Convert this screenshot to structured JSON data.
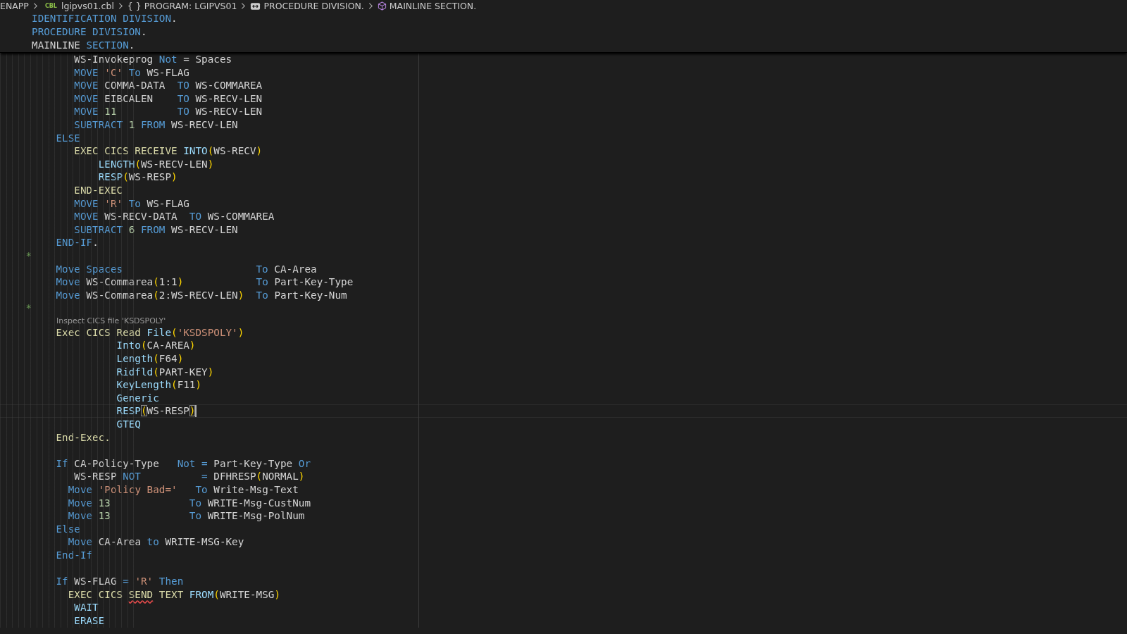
{
  "breadcrumb": [
    {
      "kind": "text",
      "text": "ENAPP"
    },
    {
      "kind": "file",
      "badge": "CBL",
      "text": "lgipvs01.cbl"
    },
    {
      "kind": "braces",
      "glyph": "{ }",
      "text": "PROGRAM: LGIPVS01"
    },
    {
      "kind": "division",
      "text": "PROCEDURE DIVISION."
    },
    {
      "kind": "section",
      "text": "MAINLINE SECTION."
    }
  ],
  "sticky_lines": [
    {
      "kind": "code",
      "tokens": [
        {
          "text": "     IDENTIFICATION DIVISION",
          "kind": "kw"
        },
        {
          "text": ".",
          "kind": "id"
        }
      ]
    },
    {
      "kind": "code",
      "tokens": [
        {
          "text": "     PROCEDURE DIVISION",
          "kind": "kw"
        },
        {
          "text": ".",
          "kind": "id"
        }
      ]
    },
    {
      "kind": "code",
      "tokens": [
        {
          "text": "     MAINLINE ",
          "kind": "id"
        },
        {
          "text": "SECTION",
          "kind": "kw"
        },
        {
          "text": ".",
          "kind": "id"
        }
      ]
    }
  ],
  "lines": [
    {
      "kind": "code",
      "tokens": [
        {
          "text": "            WS-Invokeprog ",
          "kind": "id"
        },
        {
          "text": "Not",
          "kind": "kw"
        },
        {
          "text": " = Spaces",
          "kind": "id"
        }
      ]
    },
    {
      "kind": "code",
      "tokens": [
        {
          "text": "            MOVE ",
          "kind": "kw"
        },
        {
          "text": "'C' ",
          "kind": "str"
        },
        {
          "text": "To ",
          "kind": "kw"
        },
        {
          "text": "WS-FLAG",
          "kind": "id"
        }
      ]
    },
    {
      "kind": "code",
      "tokens": [
        {
          "text": "            MOVE ",
          "kind": "kw"
        },
        {
          "text": "COMMA-DATA  ",
          "kind": "id"
        },
        {
          "text": "TO ",
          "kind": "kw"
        },
        {
          "text": "WS-COMMAREA",
          "kind": "id"
        }
      ]
    },
    {
      "kind": "code",
      "tokens": [
        {
          "text": "            MOVE ",
          "kind": "kw"
        },
        {
          "text": "EIBCALEN    ",
          "kind": "id"
        },
        {
          "text": "TO ",
          "kind": "kw"
        },
        {
          "text": "WS-RECV-LEN",
          "kind": "id"
        }
      ]
    },
    {
      "kind": "code",
      "tokens": [
        {
          "text": "            MOVE ",
          "kind": "kw"
        },
        {
          "text": "11          ",
          "kind": "num"
        },
        {
          "text": "TO ",
          "kind": "kw"
        },
        {
          "text": "WS-RECV-LEN",
          "kind": "id"
        }
      ]
    },
    {
      "kind": "code",
      "tokens": [
        {
          "text": "            SUBTRACT ",
          "kind": "kw"
        },
        {
          "text": "1 ",
          "kind": "num"
        },
        {
          "text": "FROM ",
          "kind": "kw"
        },
        {
          "text": "WS-RECV-LEN",
          "kind": "id"
        }
      ]
    },
    {
      "kind": "code",
      "tokens": [
        {
          "text": "         ELSE",
          "kind": "kw"
        }
      ]
    },
    {
      "kind": "code",
      "tokens": [
        {
          "text": "            EXEC CICS RECEIVE ",
          "kind": "cics"
        },
        {
          "text": "INTO",
          "kind": "fn"
        },
        {
          "text": "(",
          "kind": "paren"
        },
        {
          "text": "WS-RECV",
          "kind": "id"
        },
        {
          "text": ")",
          "kind": "paren"
        }
      ]
    },
    {
      "kind": "code",
      "tokens": [
        {
          "text": "                LENGTH",
          "kind": "fn"
        },
        {
          "text": "(",
          "kind": "paren"
        },
        {
          "text": "WS-RECV-LEN",
          "kind": "id"
        },
        {
          "text": ")",
          "kind": "paren"
        }
      ]
    },
    {
      "kind": "code",
      "tokens": [
        {
          "text": "                RESP",
          "kind": "fn"
        },
        {
          "text": "(",
          "kind": "paren"
        },
        {
          "text": "WS-RESP",
          "kind": "id"
        },
        {
          "text": ")",
          "kind": "paren"
        }
      ]
    },
    {
      "kind": "code",
      "tokens": [
        {
          "text": "            END-EXEC",
          "kind": "cics"
        }
      ]
    },
    {
      "kind": "code",
      "tokens": [
        {
          "text": "            MOVE ",
          "kind": "kw"
        },
        {
          "text": "'R' ",
          "kind": "str"
        },
        {
          "text": "To ",
          "kind": "kw"
        },
        {
          "text": "WS-FLAG",
          "kind": "id"
        }
      ]
    },
    {
      "kind": "code",
      "tokens": [
        {
          "text": "            MOVE ",
          "kind": "kw"
        },
        {
          "text": "WS-RECV-DATA  ",
          "kind": "id"
        },
        {
          "text": "TO ",
          "kind": "kw"
        },
        {
          "text": "WS-COMMAREA",
          "kind": "id"
        }
      ]
    },
    {
      "kind": "code",
      "tokens": [
        {
          "text": "            SUBTRACT ",
          "kind": "kw"
        },
        {
          "text": "6 ",
          "kind": "num"
        },
        {
          "text": "FROM ",
          "kind": "kw"
        },
        {
          "text": "WS-RECV-LEN",
          "kind": "id"
        }
      ]
    },
    {
      "kind": "code",
      "tokens": [
        {
          "text": "         END-IF",
          "kind": "kw"
        },
        {
          "text": ".",
          "kind": "id"
        }
      ]
    },
    {
      "kind": "code",
      "tokens": [
        {
          "text": "    *",
          "kind": "comment"
        }
      ]
    },
    {
      "kind": "code",
      "tokens": [
        {
          "text": "         Move Spaces                      To ",
          "kind": "kw"
        },
        {
          "text": "CA-Area",
          "kind": "id"
        }
      ]
    },
    {
      "kind": "code",
      "tokens": [
        {
          "text": "         Move ",
          "kind": "kw"
        },
        {
          "text": "WS-Commarea",
          "kind": "id"
        },
        {
          "text": "(",
          "kind": "paren"
        },
        {
          "text": "1:1",
          "kind": "id"
        },
        {
          "text": ")",
          "kind": "paren"
        },
        {
          "text": "            To ",
          "kind": "kw"
        },
        {
          "text": "Part-Key-Type",
          "kind": "id"
        }
      ]
    },
    {
      "kind": "code",
      "tokens": [
        {
          "text": "         Move ",
          "kind": "kw"
        },
        {
          "text": "WS-Commarea",
          "kind": "id"
        },
        {
          "text": "(",
          "kind": "paren"
        },
        {
          "text": "2:WS-RECV-LEN",
          "kind": "id"
        },
        {
          "text": ")",
          "kind": "paren"
        },
        {
          "text": "  To ",
          "kind": "kw"
        },
        {
          "text": "Part-Key-Num",
          "kind": "id"
        }
      ]
    },
    {
      "kind": "code",
      "tokens": [
        {
          "text": "    *",
          "kind": "comment"
        }
      ]
    },
    {
      "kind": "lens",
      "text": "Inspect CICS file 'KSDSPOLY'"
    },
    {
      "kind": "code",
      "tokens": [
        {
          "text": "         Exec CICS Read ",
          "kind": "cics"
        },
        {
          "text": "File",
          "kind": "fn"
        },
        {
          "text": "(",
          "kind": "paren"
        },
        {
          "text": "'KSDSPOLY'",
          "kind": "str"
        },
        {
          "text": ")",
          "kind": "paren"
        }
      ]
    },
    {
      "kind": "code",
      "tokens": [
        {
          "text": "                   Into",
          "kind": "fn"
        },
        {
          "text": "(",
          "kind": "paren"
        },
        {
          "text": "CA-AREA",
          "kind": "id"
        },
        {
          "text": ")",
          "kind": "paren"
        }
      ]
    },
    {
      "kind": "code",
      "tokens": [
        {
          "text": "                   Length",
          "kind": "fn"
        },
        {
          "text": "(",
          "kind": "paren"
        },
        {
          "text": "F64",
          "kind": "id"
        },
        {
          "text": ")",
          "kind": "paren"
        }
      ]
    },
    {
      "kind": "code",
      "tokens": [
        {
          "text": "                   Ridfld",
          "kind": "fn"
        },
        {
          "text": "(",
          "kind": "paren"
        },
        {
          "text": "PART-KEY",
          "kind": "id"
        },
        {
          "text": ")",
          "kind": "paren"
        }
      ]
    },
    {
      "kind": "code",
      "tokens": [
        {
          "text": "                   KeyLength",
          "kind": "fn"
        },
        {
          "text": "(",
          "kind": "paren"
        },
        {
          "text": "F11",
          "kind": "id"
        },
        {
          "text": ")",
          "kind": "paren"
        }
      ]
    },
    {
      "kind": "code",
      "tokens": [
        {
          "text": "                   Generic",
          "kind": "fn"
        }
      ]
    },
    {
      "kind": "code",
      "current": true,
      "cursor": true,
      "tokens": [
        {
          "text": "                   RESP",
          "kind": "fn"
        },
        {
          "text": "(",
          "kind": "pmatch"
        },
        {
          "text": "WS-RESP",
          "kind": "id"
        },
        {
          "text": ")",
          "kind": "pmatch"
        }
      ]
    },
    {
      "kind": "code",
      "tokens": [
        {
          "text": "                   GTEQ",
          "kind": "fn"
        }
      ]
    },
    {
      "kind": "code",
      "tokens": [
        {
          "text": "         End-Exec.",
          "kind": "cics"
        }
      ]
    },
    {
      "kind": "blank"
    },
    {
      "kind": "code",
      "tokens": [
        {
          "text": "         If ",
          "kind": "kw"
        },
        {
          "text": "CA-Policy-Type   ",
          "kind": "id"
        },
        {
          "text": "Not = ",
          "kind": "kw"
        },
        {
          "text": "Part-Key-Type ",
          "kind": "id"
        },
        {
          "text": "Or",
          "kind": "kw"
        }
      ]
    },
    {
      "kind": "code",
      "tokens": [
        {
          "text": "            WS-RESP ",
          "kind": "id"
        },
        {
          "text": "NOT          = ",
          "kind": "kw"
        },
        {
          "text": "DFHRESP",
          "kind": "id"
        },
        {
          "text": "(",
          "kind": "paren"
        },
        {
          "text": "NORMAL",
          "kind": "id"
        },
        {
          "text": ")",
          "kind": "paren"
        }
      ]
    },
    {
      "kind": "code",
      "tokens": [
        {
          "text": "           Move ",
          "kind": "kw"
        },
        {
          "text": "'Policy Bad='",
          "kind": "str"
        },
        {
          "text": "   To ",
          "kind": "kw"
        },
        {
          "text": "Write-Msg-Text",
          "kind": "id"
        }
      ]
    },
    {
      "kind": "code",
      "tokens": [
        {
          "text": "           Move ",
          "kind": "kw"
        },
        {
          "text": "13             ",
          "kind": "num"
        },
        {
          "text": "To ",
          "kind": "kw"
        },
        {
          "text": "WRITE-Msg-CustNum",
          "kind": "id"
        }
      ]
    },
    {
      "kind": "code",
      "tokens": [
        {
          "text": "           Move ",
          "kind": "kw"
        },
        {
          "text": "13             ",
          "kind": "num"
        },
        {
          "text": "To ",
          "kind": "kw"
        },
        {
          "text": "WRITE-Msg-PolNum",
          "kind": "id"
        }
      ]
    },
    {
      "kind": "code",
      "tokens": [
        {
          "text": "         Else",
          "kind": "kw"
        }
      ]
    },
    {
      "kind": "code",
      "tokens": [
        {
          "text": "           Move ",
          "kind": "kw"
        },
        {
          "text": "CA-Area ",
          "kind": "id"
        },
        {
          "text": "to ",
          "kind": "kw"
        },
        {
          "text": "WRITE-MSG-Key",
          "kind": "id"
        }
      ]
    },
    {
      "kind": "code",
      "tokens": [
        {
          "text": "         End-If",
          "kind": "kw"
        }
      ]
    },
    {
      "kind": "blank"
    },
    {
      "kind": "code",
      "tokens": [
        {
          "text": "         If ",
          "kind": "kw"
        },
        {
          "text": "WS-FLAG ",
          "kind": "id"
        },
        {
          "text": "= ",
          "kind": "kw"
        },
        {
          "text": "'R' ",
          "kind": "str"
        },
        {
          "text": "Then",
          "kind": "kw"
        }
      ]
    },
    {
      "kind": "code",
      "tokens": [
        {
          "text": "           EXEC CICS ",
          "kind": "cics"
        },
        {
          "text": "SEND",
          "kind": "err"
        },
        {
          "text": " TEXT ",
          "kind": "cics"
        },
        {
          "text": "FROM",
          "kind": "fn"
        },
        {
          "text": "(",
          "kind": "paren"
        },
        {
          "text": "WRITE-MSG",
          "kind": "id"
        },
        {
          "text": ")",
          "kind": "paren"
        }
      ]
    },
    {
      "kind": "code",
      "tokens": [
        {
          "text": "            WAIT",
          "kind": "fn"
        }
      ]
    },
    {
      "kind": "code",
      "tokens": [
        {
          "text": "            ERASE",
          "kind": "fn"
        }
      ]
    }
  ]
}
